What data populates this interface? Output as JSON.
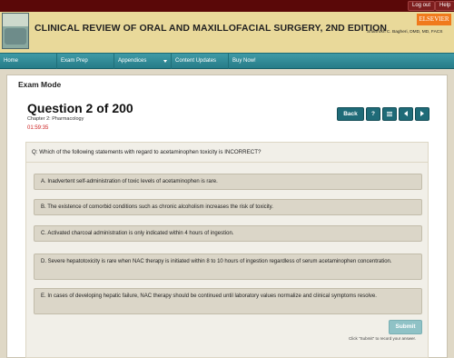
{
  "topbar": {
    "logout_label": "Log out",
    "help_label": "Help"
  },
  "header": {
    "book_title": "CLINICAL REVIEW OF ORAL AND MAXILLOFACIAL SURGERY, 2ND EDITION",
    "publisher": "ELSEVIER",
    "authors": "Shahrokh C. Bagheri, DMD, MD, FACS"
  },
  "nav": {
    "items": [
      {
        "label": "Home"
      },
      {
        "label": "Exam Prep"
      },
      {
        "label": "Appendices",
        "icon": "chevron-down-icon"
      },
      {
        "label": "Content Updates"
      },
      {
        "label": "Buy Now!"
      }
    ]
  },
  "exam": {
    "mode_label": "Exam Mode",
    "question_title": "Question 2 of 200",
    "chapter": "Chapter 2: Pharmacology",
    "timer": "01:59:35",
    "back_label": "Back",
    "help_label": "?",
    "question_text": "Q: Which of the following statements with regard to acetaminophen toxicity is INCORRECT?",
    "options": [
      {
        "text": "A. Inadvertent self-administration of toxic levels of acetaminophen is rare."
      },
      {
        "text": "B. The existence of comorbid conditions such as chronic alcoholism increases the risk of toxicity."
      },
      {
        "text": "C. Activated charcoal administration is only indicated within 4 hours of ingestion."
      },
      {
        "text": "D. Severe hepatotoxicity is rare when NAC therapy is initiated within 8 to 10 hours of ingestion regardless of serum acetaminophen concentration."
      },
      {
        "text": "E. In cases of developing hepatic failure, NAC therapy should be continued until laboratory values normalize and clinical symptoms resolve."
      }
    ],
    "submit_label": "Submit",
    "submit_hint": "Click \"Submit\" to record your answer."
  },
  "colors": {
    "topbar": "#5a0808",
    "nav": "#2f8a95",
    "accent": "#1f6b78",
    "timer": "#cc2222",
    "publisher": "#f07a1c"
  }
}
